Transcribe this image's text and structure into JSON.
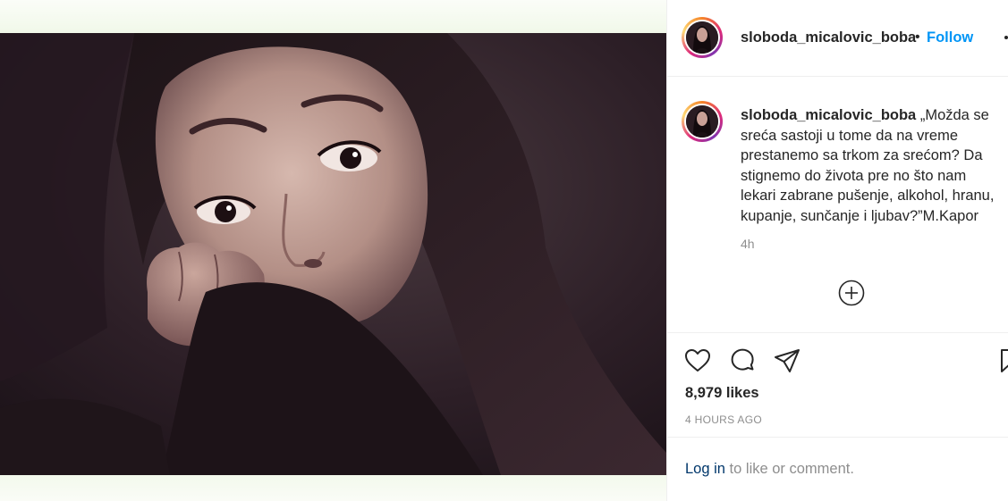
{
  "post": {
    "username": "sloboda_micalovic_boba",
    "separator": "•",
    "follow_label": "Follow",
    "caption_lines": [
      "„Možda se",
      "sreća sastoji u tome da na vreme",
      "prestanemo sa trkom za srećom? Da",
      "stignemo do života pre no što nam",
      "lekari zabrane pušenje, alkohol, hranu,",
      "kupanje, sunčanje i ljubav?”M.Kapor"
    ],
    "caption_time": "4h",
    "likes": "8,979 likes",
    "posted_ago": "4 HOURS AGO"
  },
  "footer": {
    "login_label": "Log in",
    "login_suffix": " to like or comment."
  },
  "icons": {
    "more": "more-options-icon",
    "load_more": "plus-circle-icon",
    "like": "heart-icon",
    "comment": "comment-bubble-icon",
    "share": "paper-plane-icon",
    "save": "bookmark-icon"
  },
  "colors": {
    "link_blue": "#0095f6",
    "login_blue": "#00376b",
    "muted_gray": "#8e8e8e",
    "text_dark": "#262626"
  }
}
